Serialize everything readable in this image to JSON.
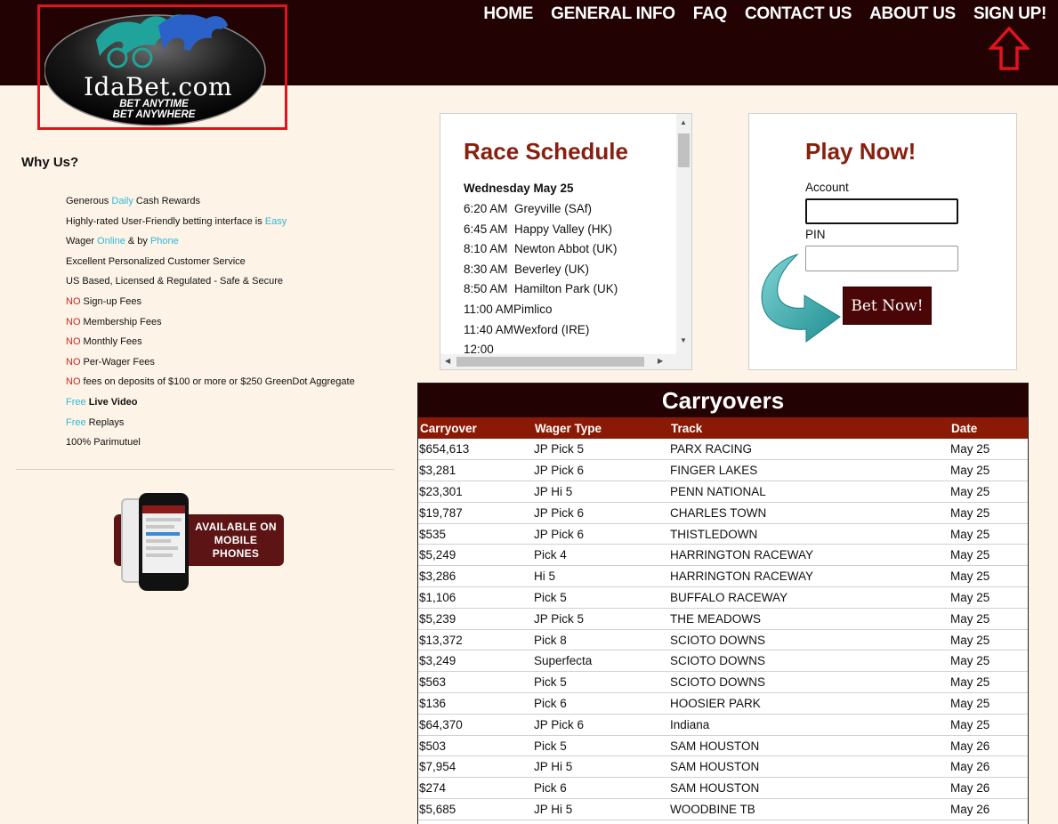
{
  "nav": {
    "items": [
      "HOME",
      "GENERAL INFO",
      "FAQ",
      "CONTACT US",
      "ABOUT US",
      "SIGN UP!"
    ]
  },
  "logo": {
    "brand": "IdaBet.com",
    "tagline1": "BET ANYTIME",
    "tagline2": "BET ANYWHERE"
  },
  "why_us": {
    "title": "Why Us?",
    "items": [
      {
        "pre": "Generous ",
        "hl": "Daily",
        "hl_color": "blue",
        "post": " Cash Rewards"
      },
      {
        "pre": "Highly-rated User-Friendly betting interface is ",
        "hl": "Easy",
        "hl_color": "blue",
        "post": ""
      },
      {
        "pre": "Wager ",
        "hl": "Online",
        "hl_color": "blue",
        "post": " & by ",
        "hl2": "Phone"
      },
      {
        "pre": "Excellent Personalized Customer Service",
        "hl": "",
        "post": ""
      },
      {
        "pre": "US Based, Licensed & Regulated - Safe & Secure",
        "hl": "",
        "post": ""
      },
      {
        "pre": "",
        "hl": "NO",
        "hl_color": "red",
        "post": " Sign-up Fees"
      },
      {
        "pre": "",
        "hl": "NO",
        "hl_color": "red",
        "post": " Membership Fees"
      },
      {
        "pre": "",
        "hl": "NO",
        "hl_color": "red",
        "post": " Monthly Fees"
      },
      {
        "pre": "",
        "hl": "NO",
        "hl_color": "red",
        "post": " Per-Wager Fees"
      },
      {
        "pre": "",
        "hl": "NO",
        "hl_color": "red",
        "post": " fees on deposits of $100 or more or $250 GreenDot Aggregate"
      },
      {
        "pre": "",
        "hl": "Free",
        "hl_color": "blue",
        "post": " ",
        "bold": "Live Video"
      },
      {
        "pre": "",
        "hl": "Free",
        "hl_color": "blue",
        "post": " Replays"
      },
      {
        "pre": "100% Parimutuel",
        "hl": "",
        "post": ""
      }
    ]
  },
  "mobile_badge": {
    "line1": "AVAILABLE ON",
    "line2": "MOBILE",
    "line3": "PHONES"
  },
  "schedule": {
    "title": "Race Schedule",
    "day": "Wednesday May 25",
    "rows": [
      {
        "time": "6:20 AM",
        "track": "Greyville (SAf)"
      },
      {
        "time": "6:45 AM",
        "track": "Happy Valley (HK)"
      },
      {
        "time": "8:10 AM",
        "track": "Newton Abbot (UK)"
      },
      {
        "time": "8:30 AM",
        "track": "Beverley (UK)"
      },
      {
        "time": "8:50 AM",
        "track": "Hamilton Park (UK)"
      },
      {
        "time": "11:00 AM",
        "track": "Pimlico"
      },
      {
        "time": "11:40 AM",
        "track": "Wexford (IRE)"
      },
      {
        "time": "12:00",
        "track": ""
      }
    ]
  },
  "play": {
    "title": "Play Now!",
    "account_label": "Account",
    "account_value": "",
    "pin_label": "PIN",
    "pin_value": "",
    "button": "Bet Now!"
  },
  "carryovers": {
    "title": "Carryovers",
    "columns": [
      "Carryover",
      "Wager Type",
      "Track",
      "Date"
    ],
    "rows": [
      [
        "$654,613",
        "JP Pick 5",
        "PARX RACING",
        "May 25"
      ],
      [
        "$3,281",
        "JP Pick 6",
        "FINGER LAKES",
        "May 25"
      ],
      [
        "$23,301",
        "JP Hi 5",
        "PENN NATIONAL",
        "May 25"
      ],
      [
        "$19,787",
        "JP Pick 6",
        "CHARLES TOWN",
        "May 25"
      ],
      [
        "$535",
        "JP Pick 6",
        "THISTLEDOWN",
        "May 25"
      ],
      [
        "$5,249",
        "Pick 4",
        "HARRINGTON RACEWAY",
        "May 25"
      ],
      [
        "$3,286",
        "Hi 5",
        "HARRINGTON RACEWAY",
        "May 25"
      ],
      [
        "$1,106",
        "Pick 5",
        "BUFFALO RACEWAY",
        "May 25"
      ],
      [
        "$5,239",
        "JP Pick 5",
        "THE MEADOWS",
        "May 25"
      ],
      [
        "$13,372",
        "Pick 8",
        "SCIOTO DOWNS",
        "May 25"
      ],
      [
        "$3,249",
        "Superfecta",
        "SCIOTO DOWNS",
        "May 25"
      ],
      [
        "$563",
        "Pick 5",
        "SCIOTO DOWNS",
        "May 25"
      ],
      [
        "$136",
        "Pick 6",
        "HOOSIER PARK",
        "May 25"
      ],
      [
        "$64,370",
        "JP Pick 6",
        "Indiana",
        "May 25"
      ],
      [
        "$503",
        "Pick 5",
        "SAM HOUSTON",
        "May 26"
      ],
      [
        "$7,954",
        "JP Hi 5",
        "SAM HOUSTON",
        "May 26"
      ],
      [
        "$274",
        "Pick 6",
        "SAM HOUSTON",
        "May 26"
      ],
      [
        "$5,685",
        "JP Hi 5",
        "WOODBINE TB",
        "May 26"
      ]
    ]
  },
  "colors": {
    "header_bg": "#220203",
    "accent_red": "#87200f",
    "table_header": "#8a1a06",
    "highlight_blue": "#2eb9d9",
    "highlight_red": "#d8211f",
    "page_bg": "#fdf3e6"
  }
}
